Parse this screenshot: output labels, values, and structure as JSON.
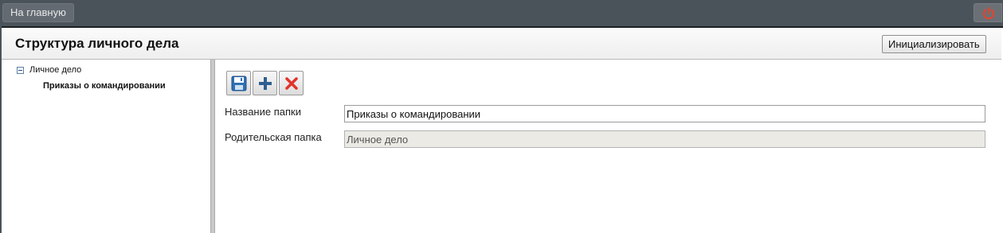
{
  "topbar": {
    "home_label": "На главную",
    "power_color": "#e0452f"
  },
  "header": {
    "title": "Структура личного дела",
    "init_label": "Инициализировать"
  },
  "tree": {
    "root_label": "Личное дело",
    "root_expanded": true,
    "child_label": "Приказы о командировании",
    "selected": "Приказы о командировании"
  },
  "toolbar": {
    "buttons": [
      "save-icon",
      "add-icon",
      "delete-icon"
    ]
  },
  "form": {
    "folder_name_label": "Название папки",
    "folder_name_value": "Приказы о командировании",
    "parent_label": "Родительская папка",
    "parent_value": "Личное дело"
  }
}
